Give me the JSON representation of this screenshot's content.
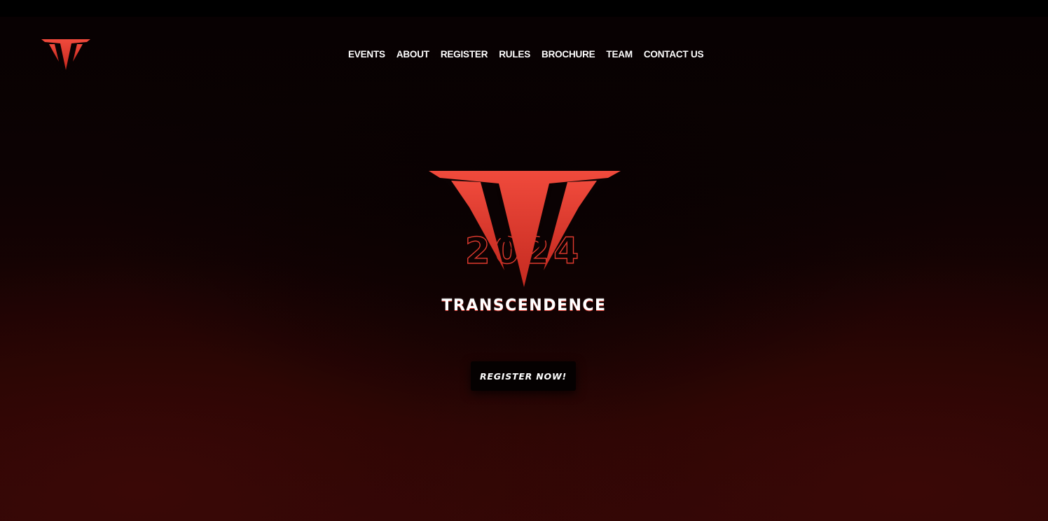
{
  "colors": {
    "accent": "#e03a2e",
    "accent_dark": "#b9261c",
    "background_top": "#070102",
    "background_bottom": "#2e0605",
    "text": "#ffffff",
    "button_bg": "#050101"
  },
  "header": {
    "logo_icon": "transcendence-logo-icon",
    "nav": [
      {
        "label": "EVENTS"
      },
      {
        "label": "ABOUT"
      },
      {
        "label": "REGISTER"
      },
      {
        "label": "RULES"
      },
      {
        "label": "BROCHURE"
      },
      {
        "label": "TEAM"
      },
      {
        "label": "CONTACT US"
      }
    ]
  },
  "hero": {
    "emblem_icon": "transcendence-emblem-icon",
    "year": "2024",
    "title": "TRANSCENDENCE",
    "cta_label": "REGISTER NOW!"
  }
}
